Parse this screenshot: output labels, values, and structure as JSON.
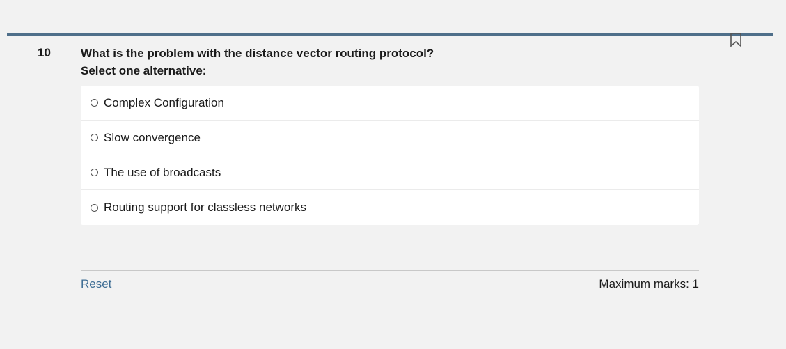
{
  "question": {
    "number": "10",
    "text": "What is the problem with the distance vector routing protocol?",
    "instruction": "Select one alternative:"
  },
  "options": [
    {
      "label": "Complex Configuration",
      "selected": false
    },
    {
      "label": "Slow convergence",
      "selected": false
    },
    {
      "label": "The use of broadcasts",
      "selected": false
    },
    {
      "label": "Routing support for classless networks",
      "selected": false
    }
  ],
  "footer": {
    "reset_label": "Reset",
    "max_marks": "Maximum marks: 1"
  },
  "icons": {
    "flag": "bookmark-icon"
  },
  "colors": {
    "accent_rule": "#4f6f8a",
    "link": "#3e6d94",
    "background": "#f2f2f2"
  }
}
